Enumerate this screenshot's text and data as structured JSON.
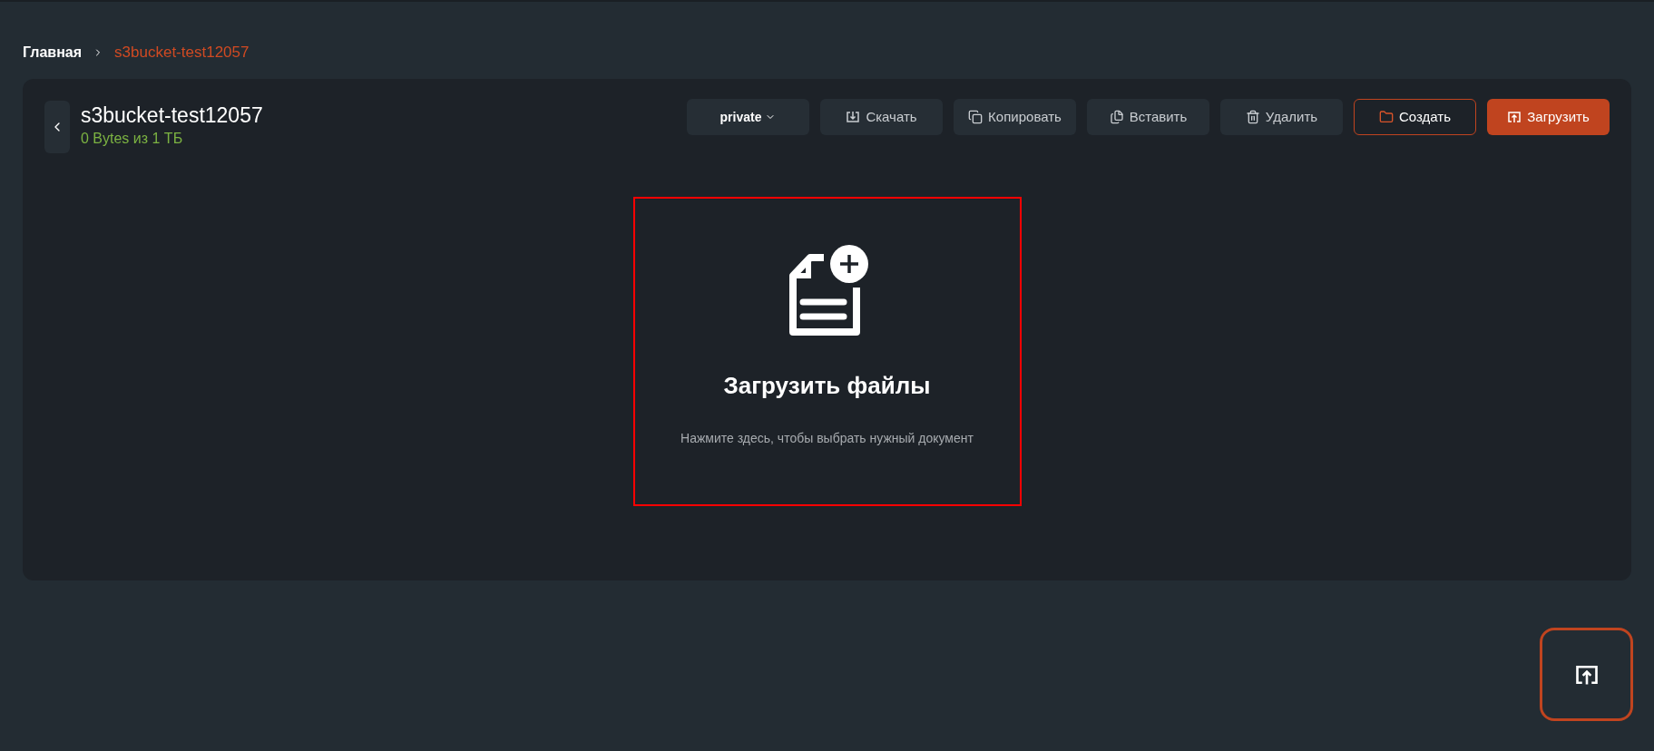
{
  "breadcrumb": [
    {
      "label": "Главная",
      "selected": false
    },
    {
      "label": "s3bucket-test12057",
      "selected": true
    }
  ],
  "bucket": {
    "title": "s3bucket-test12057",
    "usage": "0 Bytes из 1 ТБ"
  },
  "access_dropdown": {
    "value": "private"
  },
  "toolbar": [
    {
      "label": "Скачать",
      "kind": "download"
    },
    {
      "label": "Копировать",
      "kind": "copy"
    },
    {
      "label": "Вставить",
      "kind": "paste"
    },
    {
      "label": "Удалить",
      "kind": "delete"
    },
    {
      "label": "Создать",
      "kind": "create"
    },
    {
      "label": "Загрузить",
      "kind": "upload"
    }
  ],
  "dropzone": {
    "title": "Загрузить файлы",
    "hint": "Нажмите здесь, чтобы выбрать нужный документ"
  }
}
